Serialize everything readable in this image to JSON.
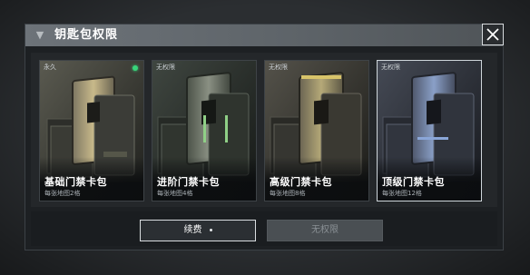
{
  "window": {
    "title": "钥匙包权限",
    "close_icon": "close-icon",
    "chevron_icon": "chevron-down-icon"
  },
  "cards": [
    {
      "tag": "永久",
      "name": "基础门禁卡包",
      "sub": "每张地图2格",
      "active": true,
      "accent": "#c8b98a"
    },
    {
      "tag": "无权限",
      "name": "进阶门禁卡包",
      "sub": "每张地图4格",
      "active": false,
      "accent": "#8fcf86"
    },
    {
      "tag": "无权限",
      "name": "高级门禁卡包",
      "sub": "每张地图8格",
      "active": false,
      "accent": "#d8c46a"
    },
    {
      "tag": "无权限",
      "name": "顶级门禁卡包",
      "sub": "每张地图12格",
      "active": false,
      "accent": "#8aa6d8"
    }
  ],
  "buttons": {
    "renew": "续费",
    "no_permission": "无权限"
  }
}
